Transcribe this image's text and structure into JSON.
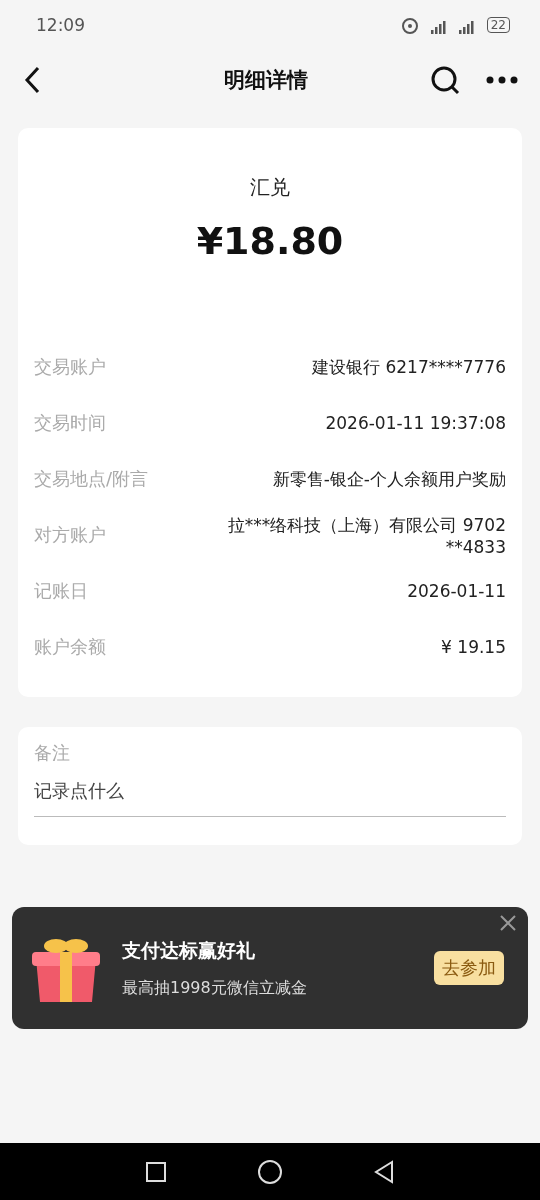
{
  "status_bar": {
    "time": "12:09",
    "battery": "22"
  },
  "header": {
    "title": "明细详情"
  },
  "summary": {
    "type": "汇兑",
    "amount": "¥18.80"
  },
  "details": [
    {
      "label": "交易账户",
      "value": "建设银行 6217****7776"
    },
    {
      "label": "交易时间",
      "value": "2026-01-11 19:37:08"
    },
    {
      "label": "交易地点/附言",
      "value": "新零售-银企-个人余额用户奖励"
    },
    {
      "label": "对方账户",
      "value": "拉***络科技（上海）有限公司 9702 **4833"
    },
    {
      "label": "记账日",
      "value": "2026-01-11"
    },
    {
      "label": "账户余额",
      "value": "¥ 19.15"
    }
  ],
  "note": {
    "label": "备注",
    "placeholder": "记录点什么"
  },
  "promo": {
    "title": "支付达标赢好礼",
    "subtitle": "最高抽1998元微信立减金",
    "button": "去参加"
  }
}
